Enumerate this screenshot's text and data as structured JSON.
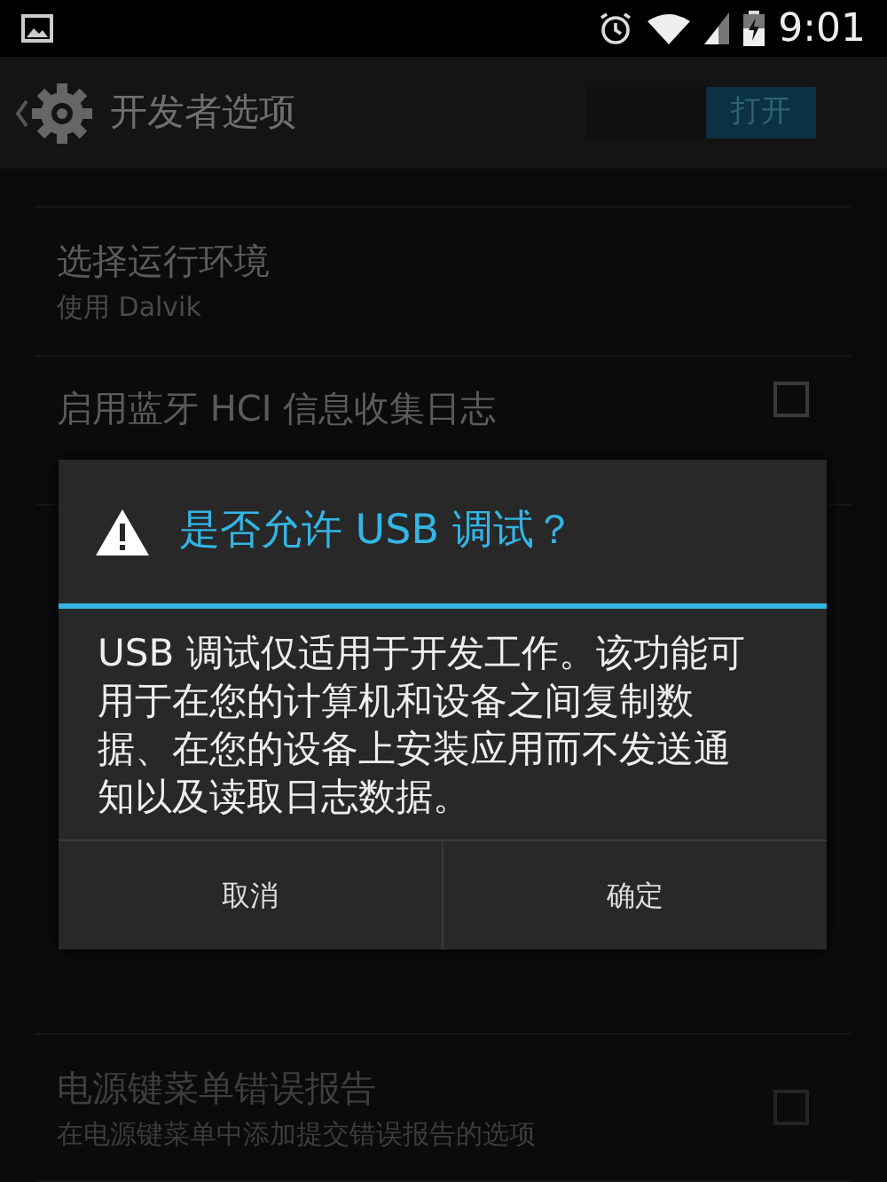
{
  "status_bar": {
    "time": "9:01"
  },
  "action_bar": {
    "title": "开发者选项",
    "switch": {
      "label": "打开",
      "on": true
    }
  },
  "settings": [
    {
      "kind": "plain",
      "title": "选择运行环境",
      "summary": "使用 Dalvik",
      "disabled": false
    },
    {
      "kind": "checkbox",
      "title": "启用蓝牙 HCI 信息收集日志",
      "checked": false,
      "disabled": false
    },
    {
      "kind": "checkbox",
      "title": "电源键菜单错误报告",
      "summary": "在电源键菜单中添加提交错误报告的选项",
      "checked": false,
      "disabled": true
    }
  ],
  "dialog": {
    "title": "是否允许 USB 调试？",
    "message": "USB 调试仅适用于开发工作。该功能可用于在您的计算机和设备之间复制数据、在您的设备上安装应用而不发送通知以及读取日志数据。",
    "buttons": [
      "取消",
      "确定"
    ]
  }
}
